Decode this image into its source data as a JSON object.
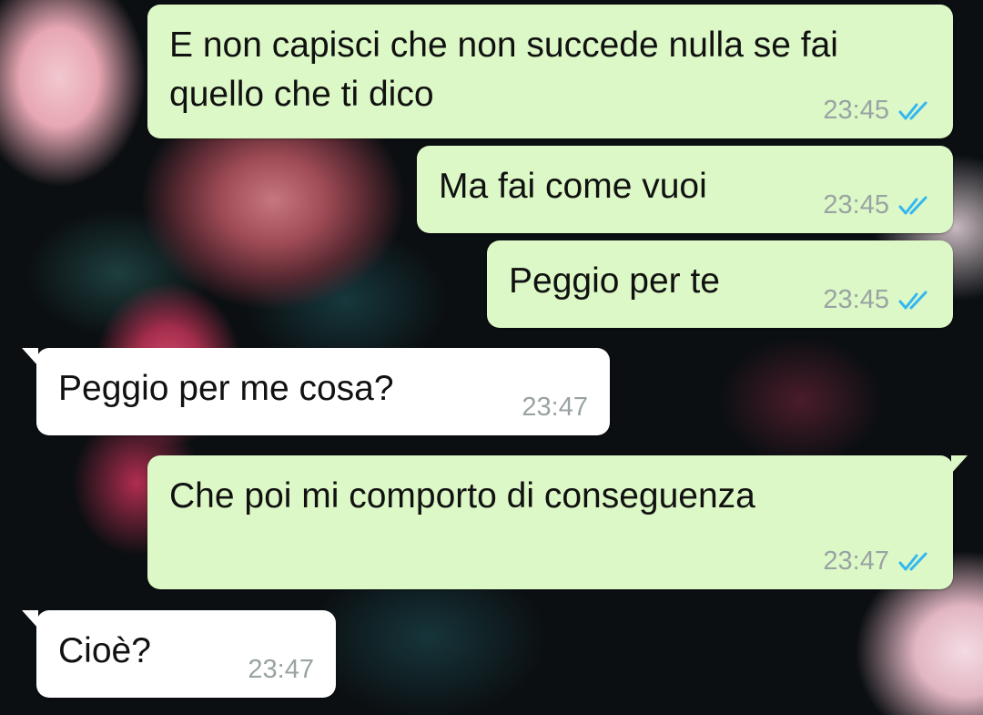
{
  "chat": {
    "messages": [
      {
        "direction": "outgoing",
        "text": "E non capisci che non succede nulla se fai\nquello che ti dico",
        "time": "23:45",
        "status_icon": "double-check-read-icon"
      },
      {
        "direction": "outgoing",
        "text": "Ma fai come vuoi",
        "time": "23:45",
        "status_icon": "double-check-read-icon"
      },
      {
        "direction": "outgoing",
        "text": "Peggio per te",
        "time": "23:45",
        "status_icon": "double-check-read-icon"
      },
      {
        "direction": "incoming",
        "text": "Peggio per me cosa?",
        "time": "23:47"
      },
      {
        "direction": "outgoing",
        "text": "Che poi mi comporto di conseguenza",
        "time": "23:47",
        "status_icon": "double-check-read-icon"
      },
      {
        "direction": "incoming",
        "text": "Cioè?",
        "time": "23:47"
      }
    ]
  },
  "colors": {
    "outgoing_bubble": "#dcf8c6",
    "incoming_bubble": "#ffffff",
    "read_tick": "#34b7f1",
    "timestamp": "#9aa3a4"
  }
}
